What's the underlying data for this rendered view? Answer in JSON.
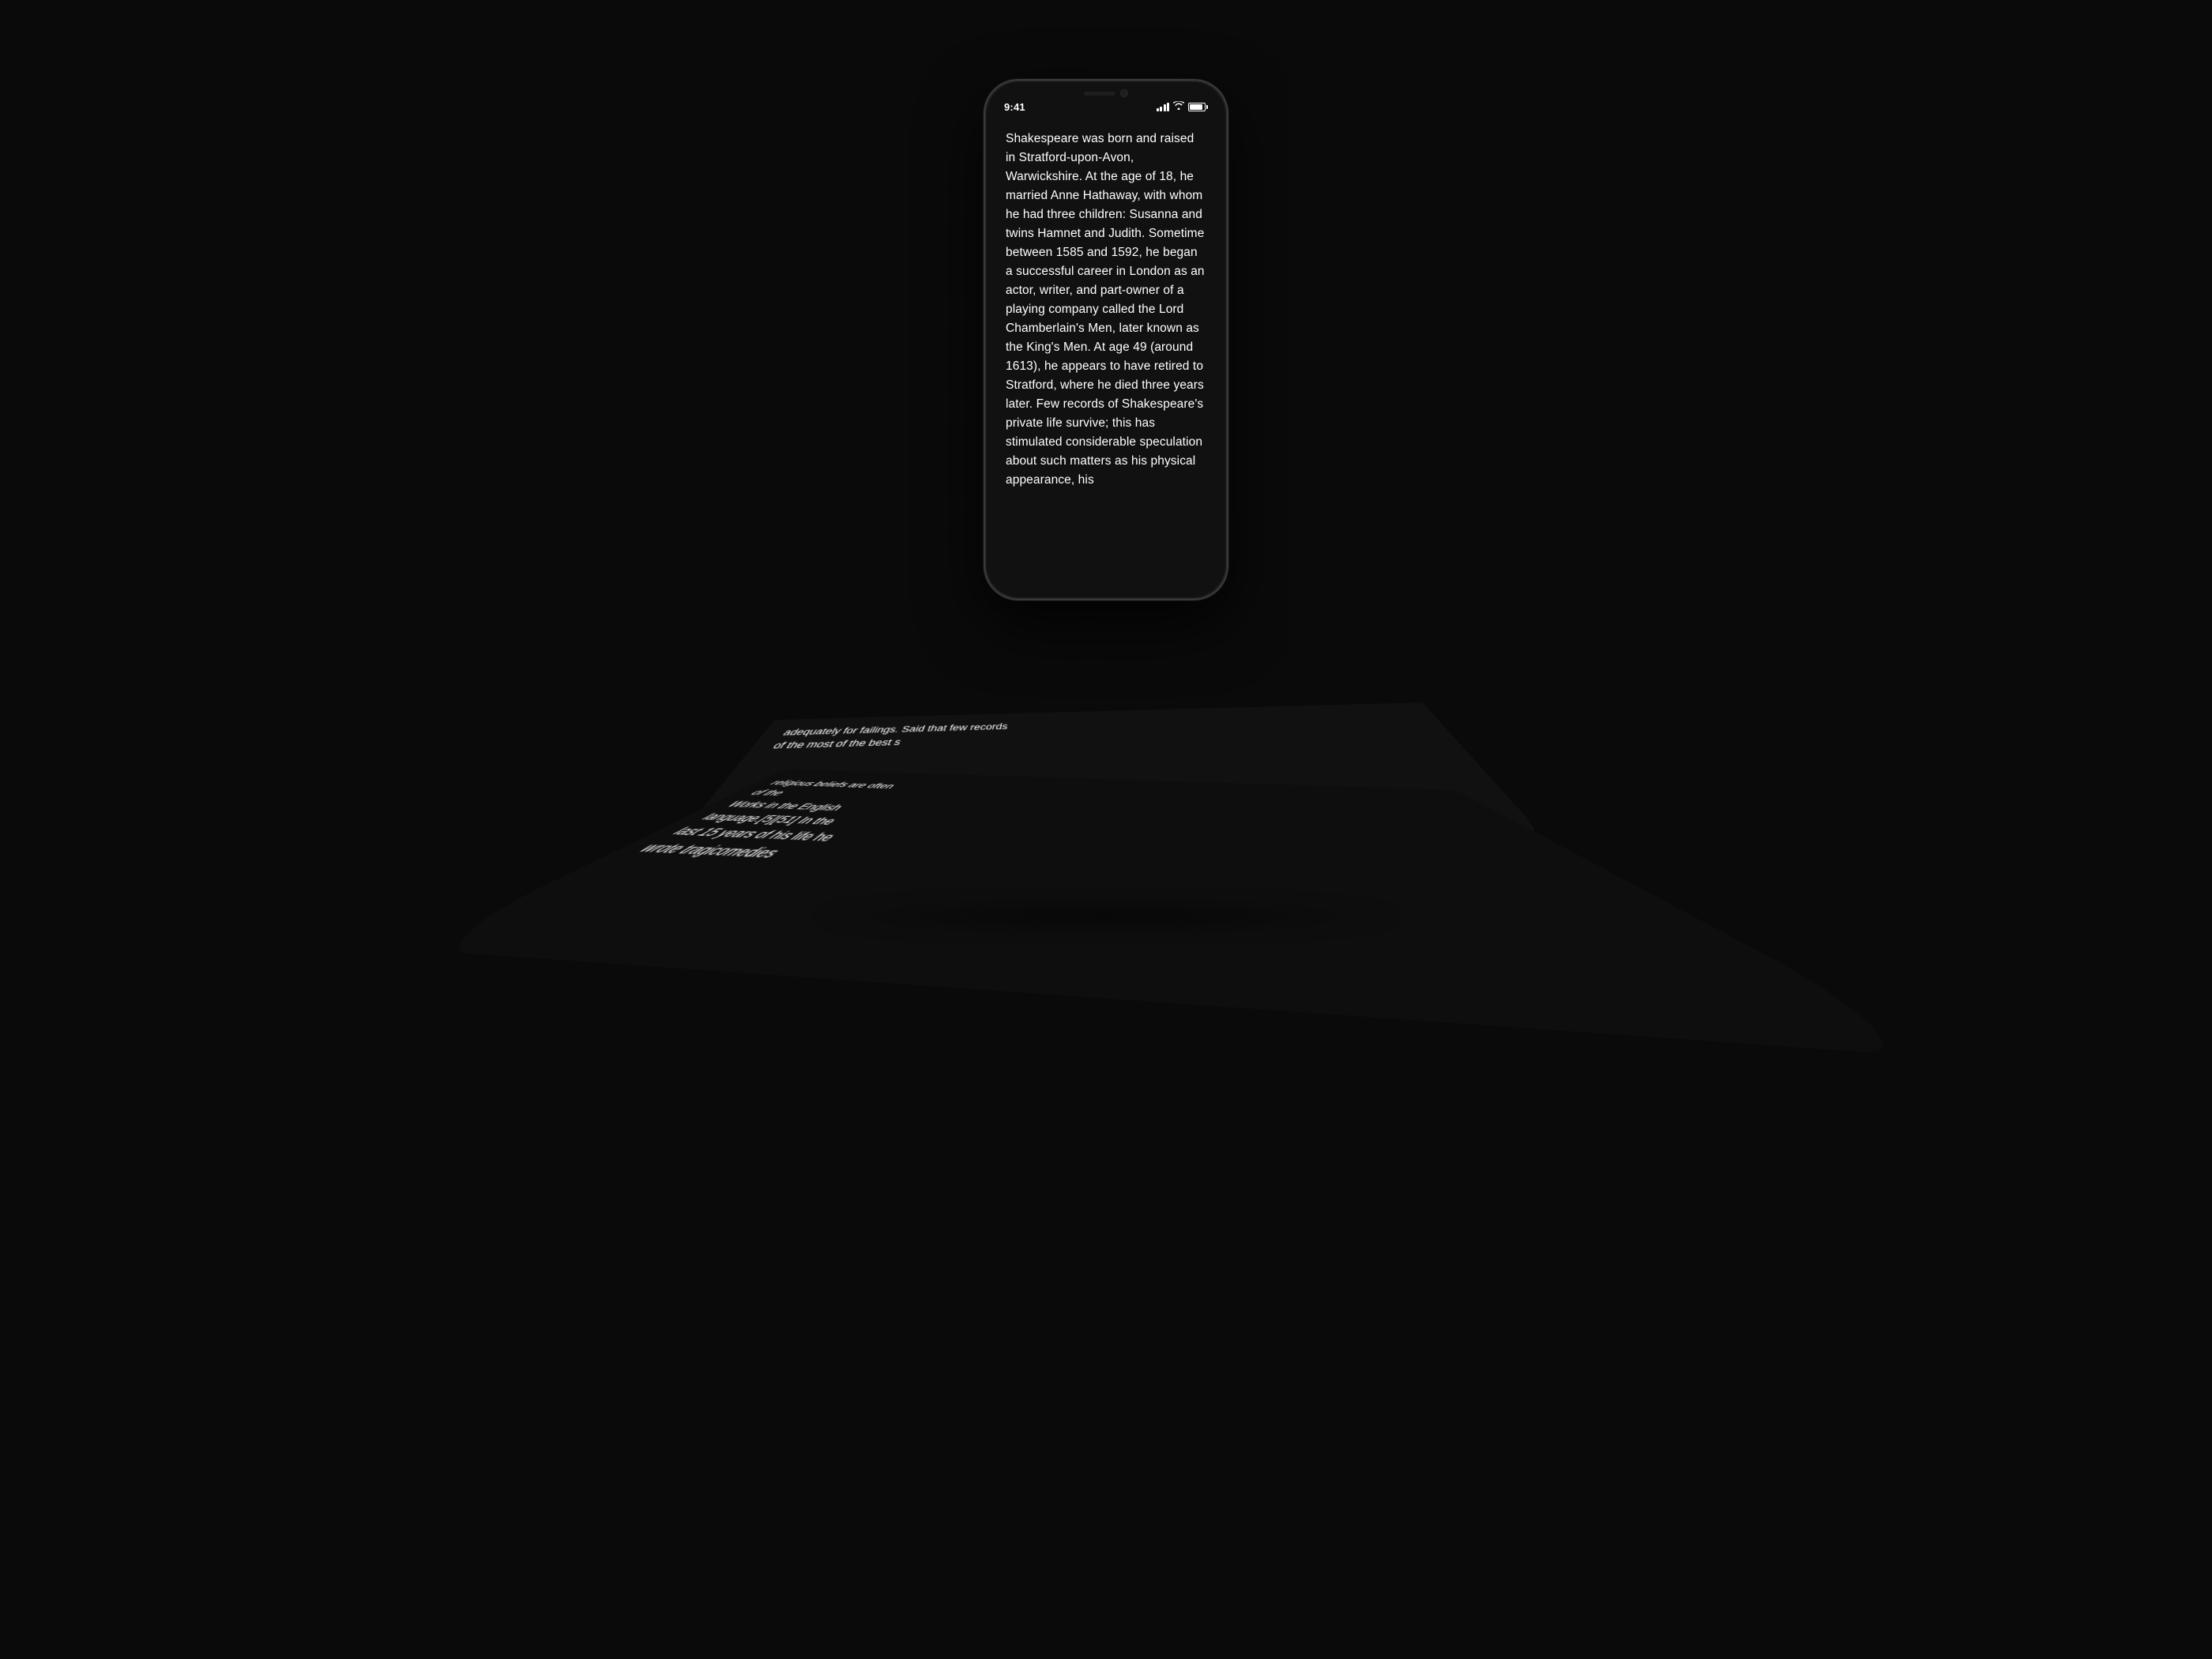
{
  "phone": {
    "status_bar": {
      "time": "9:41",
      "signal_label": "signal",
      "wifi_label": "wifi",
      "battery_label": "battery"
    },
    "main_text": "Shakespeare was born and raised in Stratford-upon-Avon, Warwickshire. At the age of 18, he married Anne Hathaway, with whom he had three children: Susanna and twins Hamnet and Judith. Sometime between 1585 and 1592, he began a successful career in London as an actor, writer, and part-owner of a playing company called the Lord Chamberlain's Men, later known as the King's Men. At age 49 (around 1613), he appears to have retired to Stratford, where he died three years later. Few records of Shakespeare's private life survive; this has stimulated considerable speculation about such matters as his physical appearance, his",
    "curl_text_1": "adequately for failings. Said that few records of the most of the best s",
    "curl_text_2": "Works in the English language.[5][51] In the last 15 years of his life he wrote tragicomedies",
    "curl_text_3": "religious beliefs are often of the"
  }
}
